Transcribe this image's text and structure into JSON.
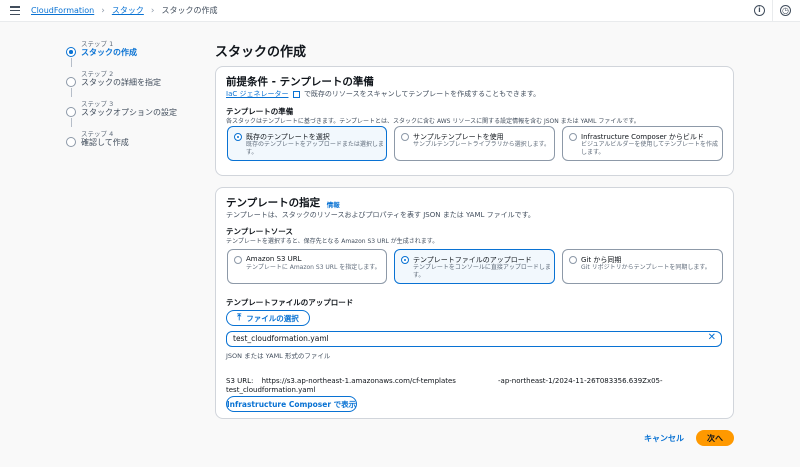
{
  "breadcrumb": {
    "items": [
      "CloudFormation",
      "スタック"
    ],
    "current": "スタックの作成"
  },
  "icons": {
    "info": "i",
    "settings": "◷"
  },
  "steps": [
    {
      "sub": "ステップ 1",
      "label": "スタックの作成"
    },
    {
      "sub": "ステップ 2",
      "label": "スタックの詳細を指定"
    },
    {
      "sub": "ステップ 3",
      "label": "スタックオプションの設定"
    },
    {
      "sub": "ステップ 4",
      "label": "確認して作成"
    }
  ],
  "page": {
    "title": "スタックの作成"
  },
  "prereq": {
    "title": "前提条件 - テンプレートの準備",
    "iac_link": "IaC ジェネレーター",
    "iac_desc": "で既存のリソースをスキャンしてテンプレートを作成することもできます。",
    "section_label": "テンプレートの準備",
    "section_desc": "各スタックはテンプレートに基づきます。テンプレートとは、スタックに含む AWS リソースに関する設定情報を含む JSON または YAML ファイルです。",
    "options": [
      {
        "title": "既存のテンプレートを選択",
        "desc": "既存のテンプレートをアップロードまたは選択します。"
      },
      {
        "title": "サンプルテンプレートを使用",
        "desc": "サンプルテンプレートライブラリから選択します。"
      },
      {
        "title": "Infrastructure Composer からビルド",
        "desc": "ビジュアルビルダーを使用してテンプレートを作成します。"
      }
    ]
  },
  "spec": {
    "title": "テンプレートの指定",
    "info": "情報",
    "desc": "テンプレートは、スタックのリソースおよびプロパティを表す JSON または YAML ファイルです。",
    "source_label": "テンプレートソース",
    "source_desc": "テンプレートを選択すると、保存先となる Amazon S3 URL が生成されます。",
    "sources": [
      {
        "title": "Amazon S3 URL",
        "desc": "テンプレートに Amazon S3 URL を指定します。"
      },
      {
        "title": "テンプレートファイルのアップロード",
        "desc": "テンプレートをコンソールに直接アップロードします。"
      },
      {
        "title": "Git から同期",
        "desc": "Git リポジトリからテンプレートを同期します。"
      }
    ],
    "upload_label": "テンプレートファイルのアップロード",
    "choose_file": "ファイルの選択",
    "file_value": "test_cloudformation.yaml",
    "file_hint": "JSON または YAML 形式のファイル",
    "s3_prefix": "S3 URL:",
    "s3_url_1": "https://s3.ap-northeast-1.amazonaws.com/cf-templates",
    "s3_url_2": "-ap-northeast-1/2024-11-26T083356.639Zx05-",
    "s3_url_3": "test_cloudformation.yaml",
    "composer_button": "Infrastructure Composer で表示"
  },
  "footer": {
    "cancel": "キャンセル",
    "next": "次へ"
  }
}
